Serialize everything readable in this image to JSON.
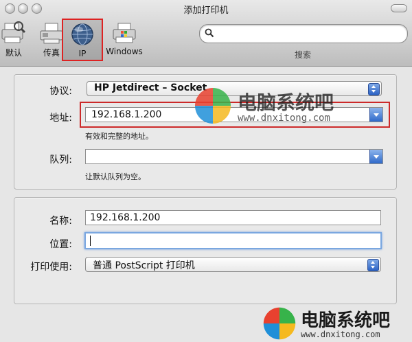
{
  "window": {
    "title": "添加打印机"
  },
  "toolbar": {
    "items": [
      {
        "label": "默认",
        "icon": "default-printer-icon"
      },
      {
        "label": "传真",
        "icon": "fax-icon"
      },
      {
        "label": "IP",
        "icon": "ip-globe-icon",
        "selected": true
      },
      {
        "label": "Windows",
        "icon": "windows-printer-icon"
      }
    ],
    "search": {
      "placeholder": "",
      "caption": "搜索"
    }
  },
  "connection": {
    "protocol_label": "协议:",
    "protocol_value": "HP Jetdirect – Socket",
    "address_label": "地址:",
    "address_value": "192.168.1.200",
    "address_hint": "有效和完整的地址。",
    "queue_label": "队列:",
    "queue_value": "",
    "queue_hint": "让默认队列为空。"
  },
  "details": {
    "name_label": "名称:",
    "name_value": "192.168.1.200",
    "location_label": "位置:",
    "location_value": "",
    "driver_label": "打印使用:",
    "driver_value": "普通 PostScript 打印机"
  },
  "watermark": {
    "name": "电脑系统吧",
    "url": "www.dnxitong.com"
  },
  "colors": {
    "highlight": "#cc2a2a",
    "accent": "#2c63c5"
  }
}
